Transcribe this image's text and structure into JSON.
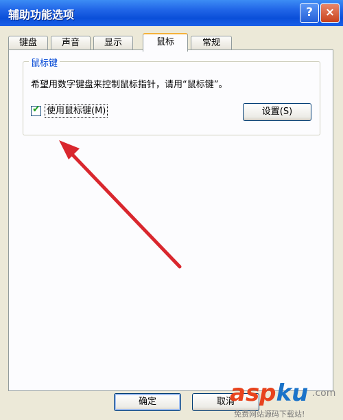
{
  "window": {
    "title": "辅助功能选项",
    "help_glyph": "?",
    "close_glyph": "×"
  },
  "tabs": [
    {
      "label": "键盘",
      "active": false
    },
    {
      "label": "声音",
      "active": false
    },
    {
      "label": "显示",
      "active": false
    },
    {
      "label": "鼠标",
      "active": true
    },
    {
      "label": "常规",
      "active": false
    }
  ],
  "group": {
    "title": "鼠标键",
    "description": "希望用数字键盘来控制鼠标指针，请用“鼠标键”。",
    "checkbox_label": "使用鼠标键(M)",
    "checkbox_checked": true,
    "settings_label": "设置(S)"
  },
  "buttons": {
    "ok": "确定",
    "cancel": "取消"
  },
  "watermark": {
    "brand": "asp",
    "brand2": "ku",
    "suffix": ".com",
    "sub": "免费网站源码下载站!"
  },
  "annotation": {
    "arrow_color": "#d9272e"
  }
}
